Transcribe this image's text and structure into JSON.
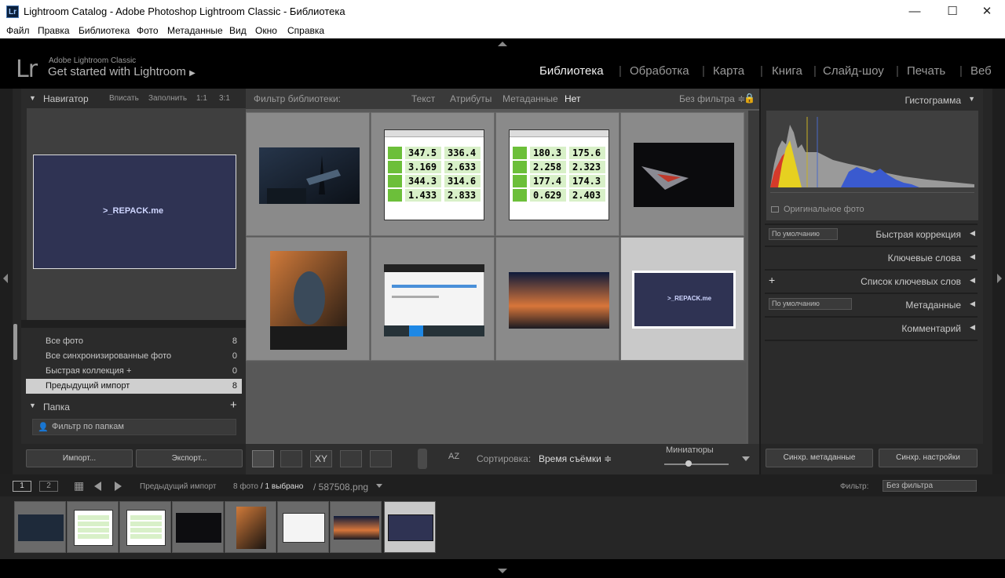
{
  "window": {
    "title": "Lightroom Catalog - Adobe Photoshop Lightroom Classic - Библиотека",
    "app_icon": "Lr",
    "min": "—",
    "max": "☐",
    "close": "✕"
  },
  "menu": [
    "Файл",
    "Правка",
    "Библиотека",
    "Фото",
    "Метаданные",
    "Вид",
    "Окно",
    "Справка"
  ],
  "identity": {
    "logo": "Lr",
    "product": "Adobe Lightroom Classic",
    "tagline": "Get started with Lightroom",
    "arrow": "▶"
  },
  "modules": [
    "Библиотека",
    "Обработка",
    "Карта",
    "Книга",
    "Слайд-шоу",
    "Печать",
    "Веб"
  ],
  "navigator": {
    "title": "Навигатор",
    "opts": [
      "Вписать",
      "Заполнить",
      "1:1",
      "3:1"
    ],
    "preview_text": ">_REPACK.me"
  },
  "catalog": {
    "rows": [
      {
        "label": "Все фото",
        "count": "8"
      },
      {
        "label": "Все синхронизированные фото",
        "count": "0"
      },
      {
        "label": "Быстрая коллекция +",
        "count": "0"
      },
      {
        "label": "Предыдущий импорт",
        "count": "8"
      }
    ]
  },
  "folders": {
    "title": "Папка",
    "add": "+",
    "filter_placeholder": "Фильтр по папкам"
  },
  "left_buttons": {
    "import": "Импорт...",
    "export": "Экспорт..."
  },
  "filterbar": {
    "label": "Фильтр библиотеки:",
    "tabs": [
      "Текст",
      "Атрибуты",
      "Метаданные",
      "Нет"
    ],
    "preset": "Без фильтра ≑"
  },
  "thumbs": {
    "speed1": [
      "347.5",
      "336.4",
      "3.169",
      "2.633",
      "344.3",
      "314.6",
      "1.433",
      "2.833"
    ],
    "speed2": [
      "180.3",
      "175.6",
      "2.258",
      "2.323",
      "177.4",
      "174.3",
      "0.629",
      "2.403"
    ],
    "repack": ">_REPACK.me"
  },
  "toolbar": {
    "sort_label": "Сортировка:",
    "sort_value": "Время съёмки ≑",
    "thumbs_label": "Миниатюры",
    "az": "AZ"
  },
  "right": {
    "histogram": "Гистограмма",
    "original_photo": "Оригинальное фото",
    "quick_preset": "По умолчанию",
    "quick": "Быстрая коррекция",
    "keywording": "Ключевые слова",
    "keyword_list": "Список ключевых слов",
    "kw_add": "+",
    "meta_preset": "По умолчанию",
    "metadata": "Метаданные",
    "comments": "Комментарий",
    "sync_meta": "Синхр. метаданные",
    "sync_settings": "Синхр. настройки"
  },
  "filmstrip": {
    "page1": "1",
    "page2": "2",
    "source": "Предыдущий импорт",
    "count": "8 фото",
    "selected": "/ 1 выбрано",
    "file": "/ 587508.png",
    "filter_label": "Фильтр:",
    "filter_value": "Без фильтра"
  }
}
